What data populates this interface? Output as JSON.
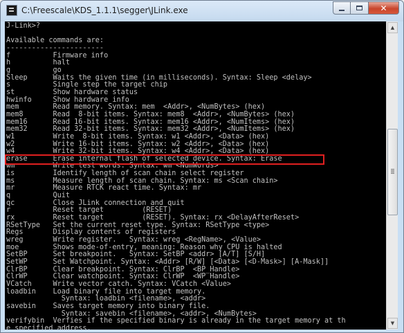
{
  "window": {
    "title": "C:\\Freescale\\KDS_1.1.1\\segger\\JLink.exe",
    "icon": "console-app-icon",
    "buttons": {
      "minimize": "minimize-icon",
      "maximize": "maximize-icon",
      "close": "close-icon",
      "close_glyph": "✕"
    }
  },
  "console": {
    "lines": [
      "J-Link>?",
      "",
      "Available commands are:",
      "-----------------------",
      "f          Firmware info",
      "h          halt",
      "g          go",
      "Sleep      Waits the given time (in milliseconds). Syntax: Sleep <delay>",
      "s          Single step the target chip",
      "st         Show hardware status",
      "hwinfo     Show hardware info",
      "mem        Read memory. Syntax: mem  <Addr>, <NumBytes> (hex)",
      "mem8       Read  8-bit items. Syntax: mem8  <Addr>, <NumBytes> (hex)",
      "mem16      Read 16-bit items. Syntax: mem16 <Addr>, <NumItems> (hex)",
      "mem32      Read 32-bit items. Syntax: mem32 <Addr>, <NumItems> (hex)",
      "w1         Write  8-bit items. Syntax: w1 <Addr>, <Data> (hex)",
      "w2         Write 16-bit items. Syntax: w2 <Addr>, <Data> (hex)",
      "w4         Write 32-bit items. Syntax: w4 <Addr>, <Data> (hex)",
      "erase      Erase internal flash of selected device. Syntax: Erase",
      "wm         Write test words. Syntax: wm <NumWords>",
      "is         Identify length of scan chain select register",
      "ms         Measure length of scan chain. Syntax: ms <Scan chain>",
      "mr         Measure RTCK react time. Syntax: mr",
      "q          Quit",
      "qc         Close JLink connection and quit",
      "r          Reset target         (RESET)",
      "rx         Reset target         (RESET). Syntax: rx <DelayAfterReset>",
      "RSetType   Set the current reset type. Syntax: RSetType <type>",
      "Regs       Display contents of registers",
      "wreg       Write register.   Syntax: wreg <RegName>, <Value>",
      "moe        Shows mode-of-entry, meaning: Reason why CPU is halted",
      "SetBP      Set breakpoint.   Syntax: SetBP <addr> [A/T] [S/H]",
      "SetWP      Set Watchpoint. Syntax: <Addr> [R/W] [<Data> [<D-Mask>] [A-Mask]]",
      "ClrBP      Clear breakpoint. Syntax: ClrBP  <BP_Handle>",
      "ClrWP      Clear watchpoint. Syntax: ClrWP  <WP_Handle>",
      "VCatch     Write vector catch. Syntax: VCatch <Value>",
      "loadbin    Load binary file into target memory.",
      "             Syntax: loadbin <filename>, <addr>",
      "savebin    Saves target memory into binary file.",
      "             Syntax: savebin <filename>, <addr>, <NumBytes>",
      "verifybin  Verfies if the specified binary is already in the target memory at th",
      "e specified address."
    ],
    "highlighted_command": "erase",
    "highlight_color": "#e02020",
    "text_color": "#c0c0c0",
    "background": "#000000"
  },
  "scrollbar": {
    "up_icon": "scroll-up-arrow-icon",
    "down_icon": "scroll-down-arrow-icon",
    "up_glyph": "▲",
    "down_glyph": "▼"
  }
}
